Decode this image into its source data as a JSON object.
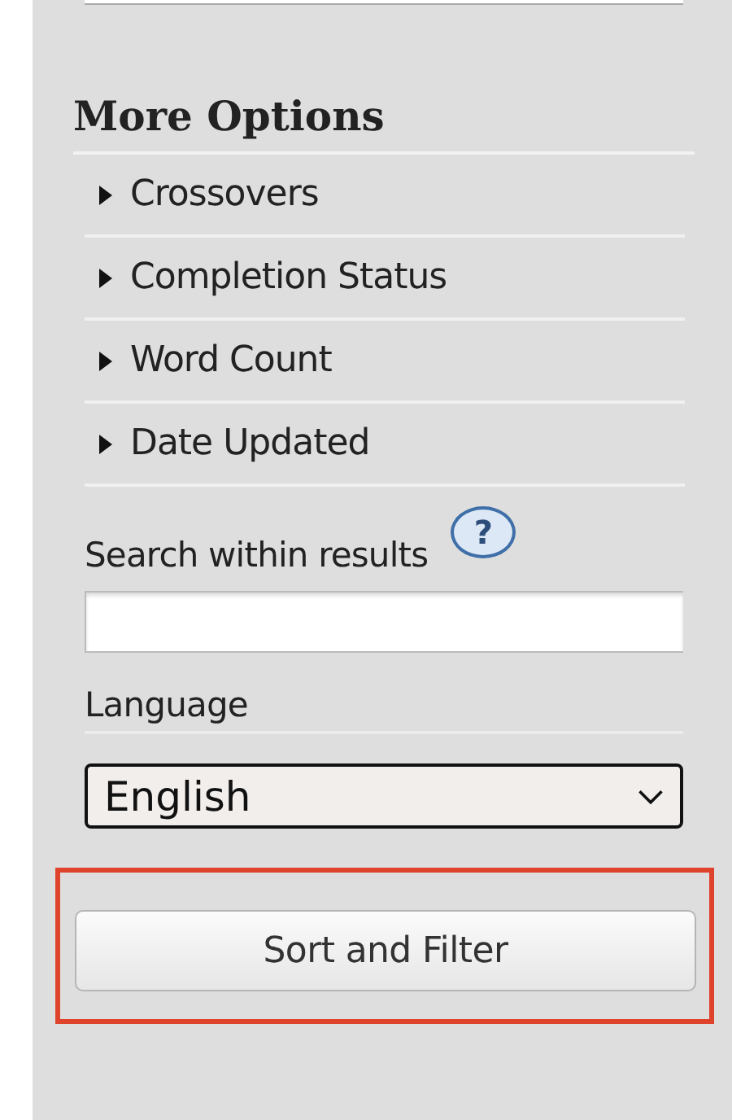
{
  "heading": "More Options",
  "sections": [
    {
      "label": "Crossovers",
      "expanded": false
    },
    {
      "label": "Completion Status",
      "expanded": false
    },
    {
      "label": "Word Count",
      "expanded": false
    },
    {
      "label": "Date Updated",
      "expanded": false
    }
  ],
  "search": {
    "label": "Search within results",
    "help": "?"
  },
  "language": {
    "label": "Language",
    "value": "English"
  },
  "submit": {
    "label": "Sort and Filter",
    "highlighted": true
  }
}
